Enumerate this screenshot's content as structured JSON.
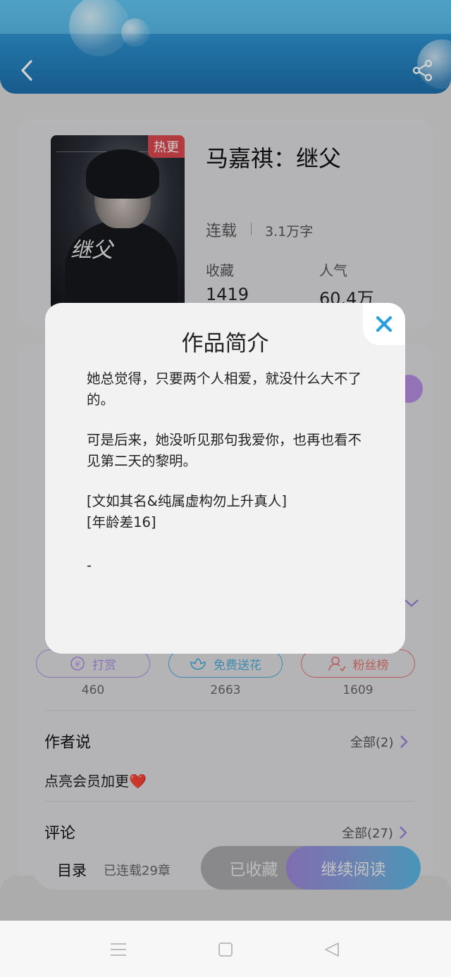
{
  "book": {
    "hot_badge": "热更",
    "title": "马嘉祺：继父",
    "status": "连载",
    "word_count": "3.1万字",
    "favorites_label": "收藏",
    "favorites_value": "1419",
    "popularity_label": "人气",
    "popularity_value": "60.4万"
  },
  "actions": [
    {
      "label": "打赏",
      "count": "460",
      "color": "#a98be0",
      "icon": "yen-icon"
    },
    {
      "label": "免费送花",
      "count": "2663",
      "color": "#4aa9d8",
      "icon": "flower-icon"
    },
    {
      "label": "粉丝榜",
      "count": "1609",
      "color": "#e0736f",
      "icon": "fan-icon"
    }
  ],
  "author_section": {
    "title": "作者说",
    "link": "全部(2)",
    "note": "点亮会员加更❤️"
  },
  "comments_section": {
    "title": "评论",
    "link": "全部(27)"
  },
  "bottom_bar": {
    "toc": "目录",
    "chapters": "已连载29章",
    "collected": "已收藏",
    "continue": "继续阅读"
  },
  "modal": {
    "title": "作品简介",
    "para1": "她总觉得，只要两个人相爱，就没什么大不了的。",
    "para2": "可是后来，她没听见那句我爱你，也再也看不见第二天的黎明。",
    "line3": "[文如其名&纯属虚构勿上升真人]",
    "line4": "[年龄差16]",
    "line5": "-"
  },
  "colors": {
    "header_blue": "#2b8dcb",
    "close_x": "#2a9fe0",
    "hot_red": "#d9484f"
  }
}
